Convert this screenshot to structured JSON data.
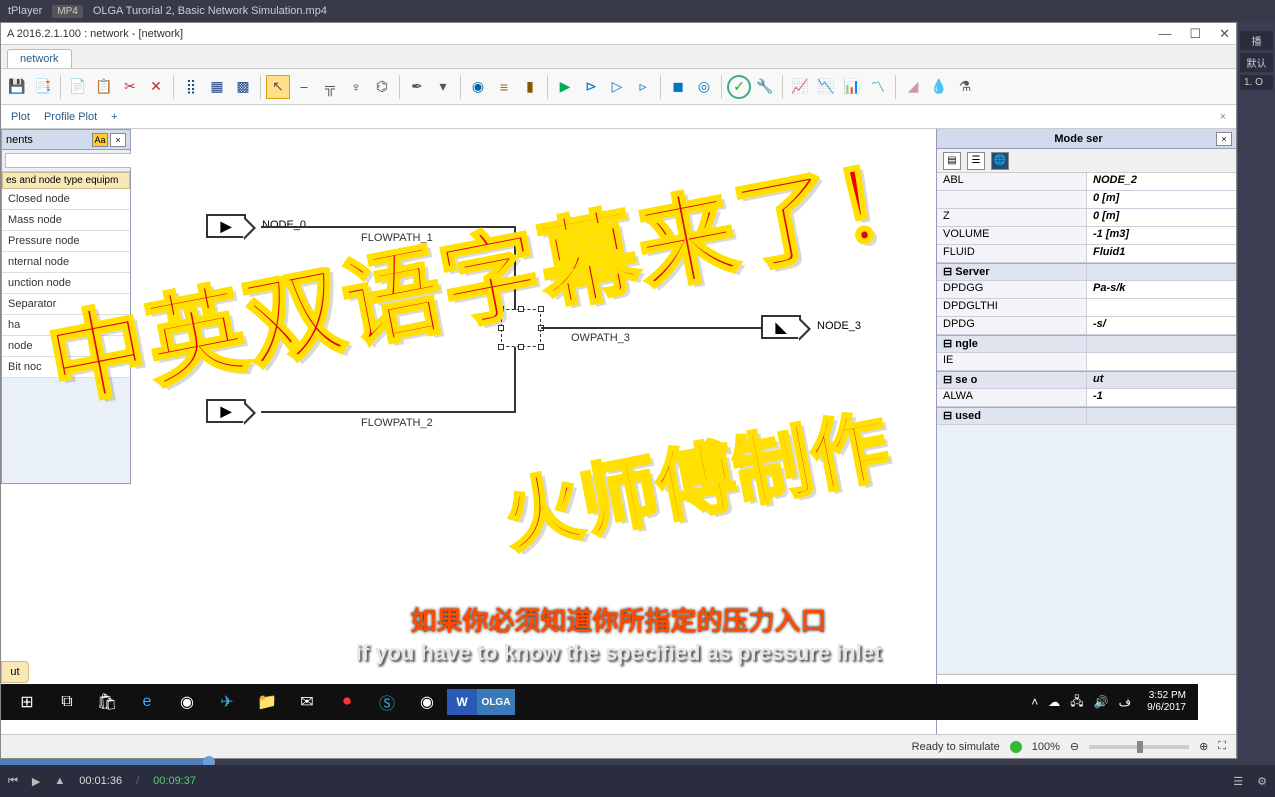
{
  "player": {
    "title_app": "tPlayer",
    "badge": "MP4",
    "file_name": "OLGA Turorial 2, Basic Network Simulation.mp4",
    "time_current": "00:01:36",
    "time_total": "00:09:37",
    "right_label1": "播",
    "right_label2": "默认",
    "right_label3": "1. O"
  },
  "olga": {
    "title": "A 2016.2.1.100 : network - [network]",
    "tab": "network",
    "sub_toolbar": {
      "plot": "Plot",
      "profile_plot": "Profile Plot",
      "plus": "+"
    },
    "out_tab": "ut"
  },
  "left_panel": {
    "title": "nents",
    "search_placeholder": "",
    "category": "es and node type equipm",
    "items": [
      "Closed node",
      "Mass node",
      "Pressure node",
      "nternal node",
      "unction node",
      "Separator",
      "ha",
      "node",
      "Bit noc"
    ]
  },
  "canvas": {
    "node0": "NODE_0",
    "node3": "NODE_3",
    "fp1": "FLOWPATH_1",
    "fp2": "FLOWPATH_2",
    "fp3": "OWPATH_3"
  },
  "model_panel": {
    "title": "Mode            ser",
    "rows": [
      {
        "k": "ABL",
        "v": "NODE_2",
        "section": false
      },
      {
        "k": "",
        "v": "0 [m]",
        "section": false
      },
      {
        "k": "Z",
        "v": "0 [m]",
        "section": false
      },
      {
        "k": "VOLUME",
        "v": "-1 [m3]",
        "section": false
      },
      {
        "k": "FLUID",
        "v": "Fluid1",
        "section": false
      },
      {
        "k": "Server",
        "v": "",
        "section": true
      },
      {
        "k": "DPDGG",
        "v": "Pa-s/k",
        "section": false
      },
      {
        "k": "DPDGLTHI",
        "v": "",
        "section": false
      },
      {
        "k": "DPDG",
        "v": "-s/",
        "section": false
      },
      {
        "k": "ngle",
        "v": "",
        "section": true
      },
      {
        "k": "IE",
        "v": "",
        "section": false
      },
      {
        "k": "se o",
        "v": "ut",
        "section": true
      },
      {
        "k": "ALWA",
        "v": "-1",
        "section": false
      },
      {
        "k": "used",
        "v": "",
        "section": true
      }
    ]
  },
  "statusbar": {
    "ready": "Ready to simulate",
    "zoom": "100%"
  },
  "taskbar": {
    "time": "3:52 PM",
    "date": "9/6/2017"
  },
  "subtitles": {
    "cn": "如果你必须知道你所指定的压力入口",
    "en": "if you have to know the specified as pressure inlet"
  },
  "overlay": {
    "line1": "中英双语字幕来了！",
    "line2": "火师傅制作"
  }
}
